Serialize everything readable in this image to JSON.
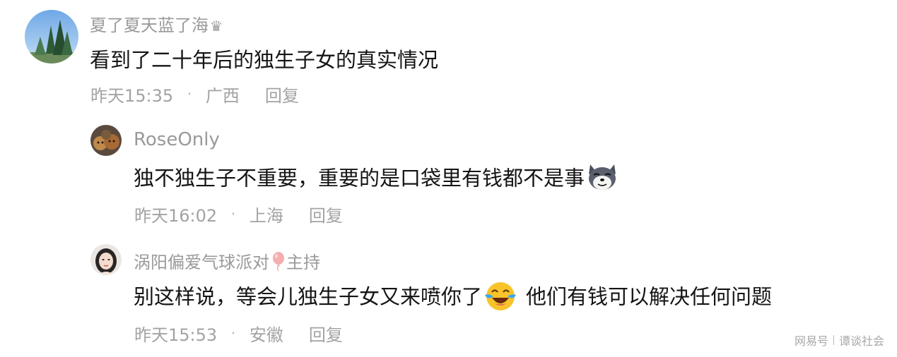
{
  "comments": [
    {
      "username": "夏了夏天蓝了海",
      "badge_glyph": "♛",
      "avatar_icon": "tree-landscape-avatar",
      "text": "看到了二十年后的独生子女的真实情况",
      "time": "昨天15:35",
      "separator": "·",
      "location": "广西",
      "reply_label": "回复"
    },
    {
      "username": "RoseOnly",
      "avatar_icon": "dogs-photo-avatar",
      "text": "独不独生子不重要，重要的是口袋里有钱都不是事",
      "emoji_icon": "husky-dog-emoji",
      "time": "昨天16:02",
      "separator": "·",
      "location": "上海",
      "reply_label": "回复"
    },
    {
      "username": "涡阳偏爱气球派对",
      "username_suffix": "主持",
      "balloon_icon": "balloon-icon",
      "avatar_icon": "woman-portrait-avatar",
      "text_part1": "别这样说，等会儿独生子女又来喷你了",
      "emoji_icon": "laughing-crying-emoji",
      "text_part2": "他们有钱可以解决任何问题",
      "time": "昨天15:53",
      "separator": "·",
      "location": "安徽",
      "reply_label": "回复"
    }
  ],
  "watermark": {
    "brand": "网易号",
    "channel": "谭谈社会"
  },
  "colors": {
    "username": "#9a9a9a",
    "body_text": "#141414",
    "meta": "#a3a3a3",
    "background": "#ffffff"
  }
}
